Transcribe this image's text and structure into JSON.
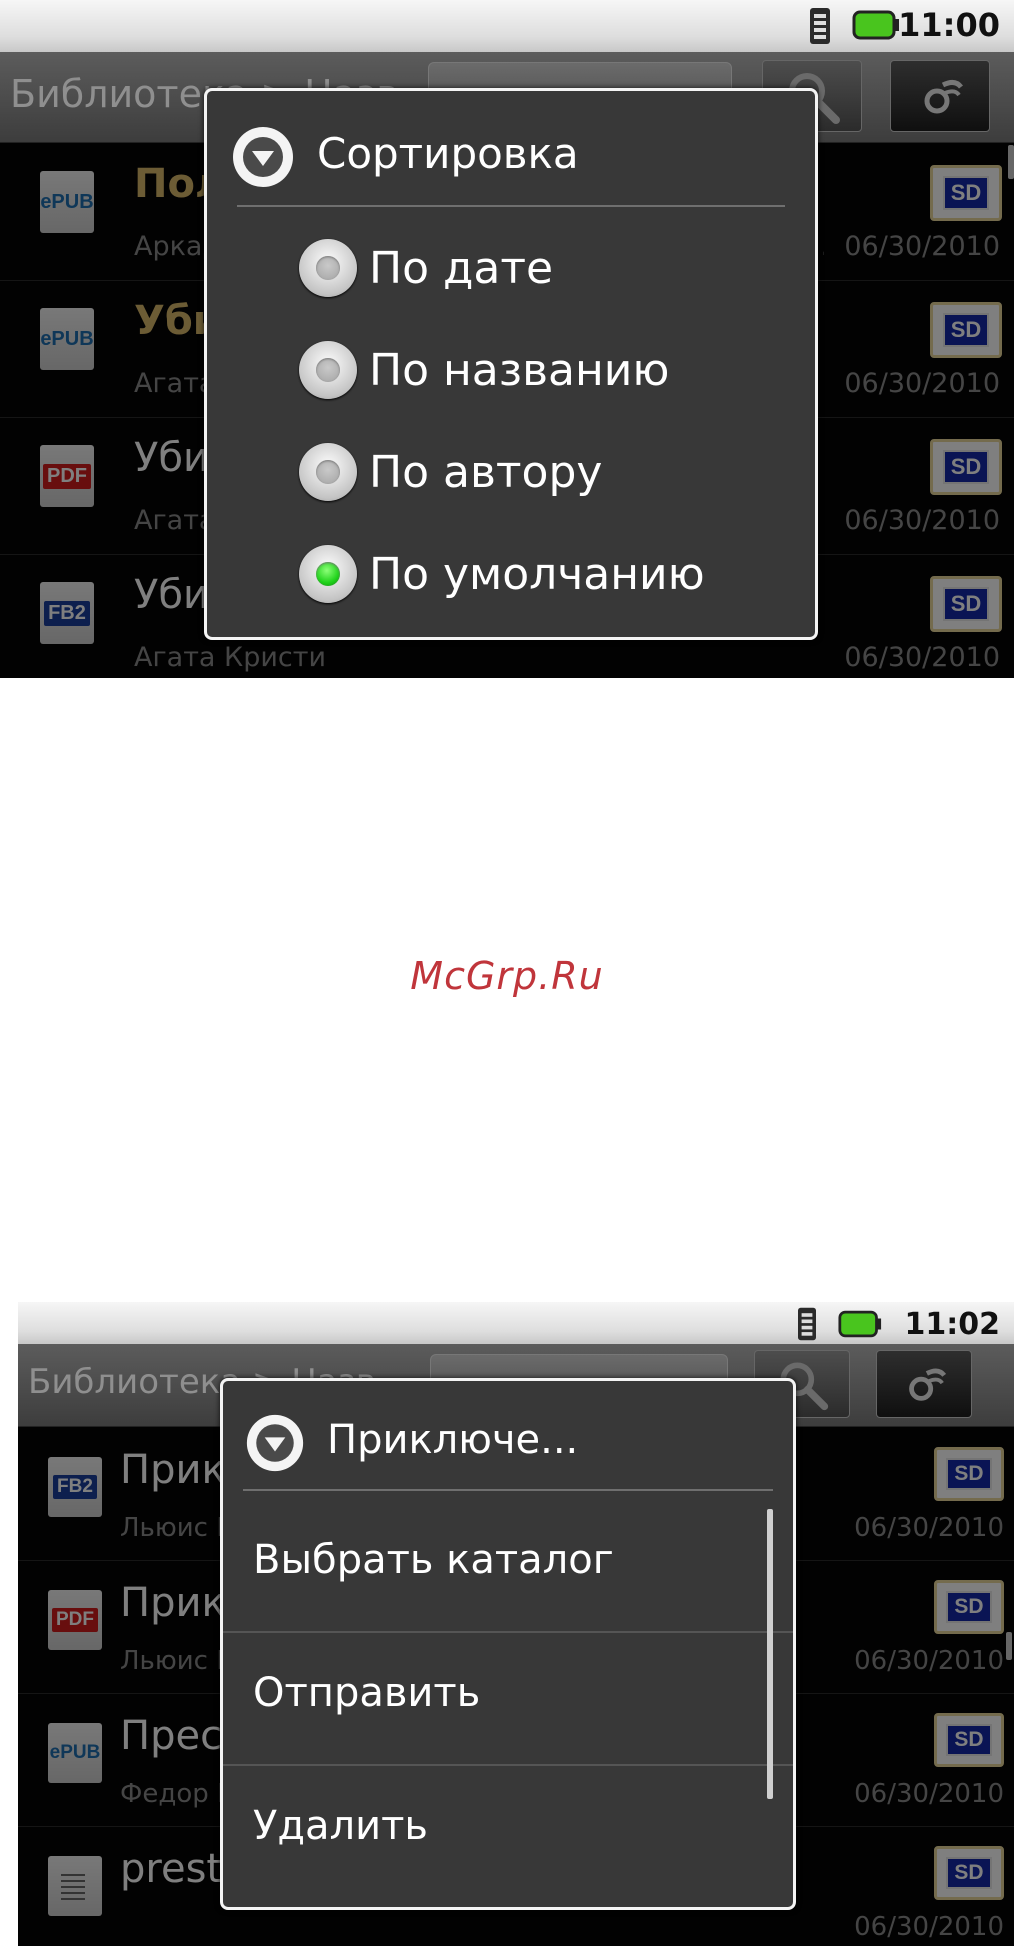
{
  "screen1": {
    "status": {
      "time": "11:00"
    },
    "titlebar": {
      "breadcrumb": "Библиотека > Назв..."
    },
    "books": [
      {
        "format": "ePUB",
        "title": "Полдень, XXII век",
        "meta": "Аркадий и Борис Стругацкие|2009-08-12T20:11:...",
        "date": "06/30/2010",
        "title_color": "#d9b86a"
      },
      {
        "format": "ePUB",
        "title": "Убийство на поле для голь...",
        "meta": "Агата Кристи",
        "date": "06/30/2010",
        "title_color": "#d9b86a"
      },
      {
        "format": "PDF",
        "title": "Убийство на поле для гольфа",
        "meta": "Агата Кристи|2009-07-11",
        "date": "06/30/2010",
        "title_color": "#ffffff"
      },
      {
        "format": "FB2",
        "title": "Убийство на поле для гольфа",
        "meta": "Агата Кристи",
        "date": "06/30/2010",
        "title_color": "#ffffff"
      }
    ],
    "sort_dialog": {
      "title": "Сортировка",
      "options": [
        {
          "label": "По дате",
          "checked": false
        },
        {
          "label": "По названию",
          "checked": false
        },
        {
          "label": "По автору",
          "checked": false
        },
        {
          "label": "По умолчанию",
          "checked": true
        }
      ]
    }
  },
  "watermark": "McGrp.Ru",
  "screen2": {
    "status": {
      "time": "11:02"
    },
    "titlebar": {
      "breadcrumb": "Библиотека > Назв..."
    },
    "books": [
      {
        "format": "FB2",
        "title": "Приключения Алисы в стран...",
        "meta": "Льюис Кэрролл",
        "date": "06/30/2010"
      },
      {
        "format": "PDF",
        "title": "Приключения Алисы в стран...",
        "meta": "Льюис Кэрролл|2009-11-01",
        "date": "06/30/2010"
      },
      {
        "format": "ePUB",
        "title": "Преступление и наказание",
        "meta": "Федор Михайлович Достоевский|2009-...",
        "date": "06/30/2010"
      },
      {
        "format": "TXT",
        "title": "prestuplenie",
        "meta": "",
        "date": "06/30/2010"
      }
    ],
    "context_menu": {
      "title": "Приключе...",
      "items": [
        "Выбрать каталог",
        "Отправить",
        "Удалить"
      ]
    }
  },
  "badge": {
    "sd": "SD"
  },
  "colors": {
    "epub": "#1f6fb0",
    "pdf": "#d01d1d",
    "fb2": "#1a3f9c",
    "watermark": "#c0353b",
    "radio_checked": "#1fd21a"
  }
}
